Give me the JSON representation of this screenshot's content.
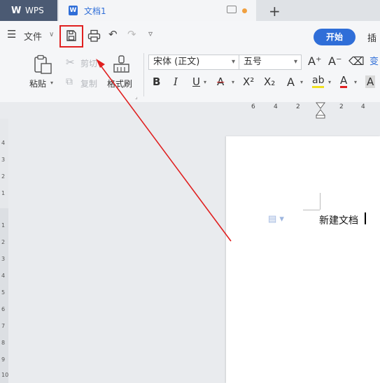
{
  "titlebar": {
    "app_tab": "WPS",
    "app_logo": "W",
    "doc_tab": "文档1",
    "new_tab": "+"
  },
  "quickbar": {
    "file_menu": "文件",
    "ribbon_tab_start": "开始",
    "ribbon_tab_insert": "插"
  },
  "ribbon": {
    "paste": "粘贴",
    "cut": "剪切",
    "copy": "复制",
    "format_painter": "格式刷",
    "font_name": "宋体 (正文)",
    "font_size": "五号",
    "bold": "B",
    "italic": "I",
    "underline": "U",
    "strike": "A",
    "superscript": "X²",
    "subscript": "X₂",
    "text_effect": "A",
    "highlight": "ab",
    "font_color": "A",
    "char_shading": "A",
    "grow": "A⁺",
    "shrink": "A⁻",
    "phonetic": "变"
  },
  "ruler": {
    "h_ticks": [
      "6",
      "4",
      "2",
      "2",
      "4"
    ],
    "v_ticks": [
      "4",
      "3",
      "2",
      "1",
      "1",
      "2",
      "3",
      "4",
      "5",
      "6",
      "7",
      "8",
      "9",
      "10"
    ]
  },
  "document": {
    "text": "新建文档"
  },
  "colors": {
    "accent": "#2f6ed8",
    "annotation": "#e02020"
  }
}
